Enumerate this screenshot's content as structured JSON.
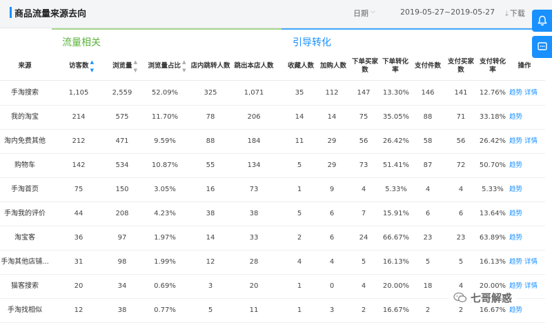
{
  "header": {
    "title": "商品流量来源去向",
    "date_label": "日期",
    "date_range": "2019-05-27~2019-05-27",
    "download_label": "下载"
  },
  "sections": {
    "traffic": "流量相关",
    "conversion": "引导转化"
  },
  "columns": {
    "source": "来源",
    "visitors": "访客数",
    "pageviews": "浏览量",
    "pv_share": "浏览量占比",
    "jump_in": "店内跳转人数",
    "jump_out": "跳出本店人数",
    "favorites": "收藏人数",
    "cart_adds": "加购人数",
    "order_buyers": "下单买家数",
    "order_rate": "下单转化率",
    "paid_items": "支付件数",
    "paid_buyers": "支付买家数",
    "pay_rate": "支付转化率",
    "actions": "操作"
  },
  "rows": [
    {
      "source": "手淘搜索",
      "visitors": "1,105",
      "pageviews": "2,559",
      "pv_share": "52.09%",
      "jump_in": "325",
      "jump_out": "1,071",
      "favorites": "35",
      "cart_adds": "112",
      "order_buyers": "147",
      "order_rate": "13.30%",
      "paid_items": "146",
      "paid_buyers": "141",
      "pay_rate": "12.76%",
      "trend": "趋势",
      "detail": "详情"
    },
    {
      "source": "我的淘宝",
      "visitors": "214",
      "pageviews": "575",
      "pv_share": "11.70%",
      "jump_in": "78",
      "jump_out": "206",
      "favorites": "14",
      "cart_adds": "14",
      "order_buyers": "75",
      "order_rate": "35.05%",
      "paid_items": "88",
      "paid_buyers": "71",
      "pay_rate": "33.18%",
      "trend": "趋势",
      "detail": ""
    },
    {
      "source": "淘内免费其他",
      "visitors": "212",
      "pageviews": "471",
      "pv_share": "9.59%",
      "jump_in": "88",
      "jump_out": "184",
      "favorites": "11",
      "cart_adds": "29",
      "order_buyers": "56",
      "order_rate": "26.42%",
      "paid_items": "58",
      "paid_buyers": "56",
      "pay_rate": "26.42%",
      "trend": "趋势",
      "detail": "详情"
    },
    {
      "source": "购物车",
      "visitors": "142",
      "pageviews": "534",
      "pv_share": "10.87%",
      "jump_in": "55",
      "jump_out": "134",
      "favorites": "5",
      "cart_adds": "29",
      "order_buyers": "73",
      "order_rate": "51.41%",
      "paid_items": "87",
      "paid_buyers": "72",
      "pay_rate": "50.70%",
      "trend": "趋势",
      "detail": ""
    },
    {
      "source": "手淘首页",
      "visitors": "75",
      "pageviews": "150",
      "pv_share": "3.05%",
      "jump_in": "16",
      "jump_out": "73",
      "favorites": "1",
      "cart_adds": "9",
      "order_buyers": "4",
      "order_rate": "5.33%",
      "paid_items": "4",
      "paid_buyers": "4",
      "pay_rate": "5.33%",
      "trend": "趋势",
      "detail": ""
    },
    {
      "source": "手淘我的评价",
      "visitors": "44",
      "pageviews": "208",
      "pv_share": "4.23%",
      "jump_in": "38",
      "jump_out": "38",
      "favorites": "5",
      "cart_adds": "6",
      "order_buyers": "7",
      "order_rate": "15.91%",
      "paid_items": "6",
      "paid_buyers": "6",
      "pay_rate": "13.64%",
      "trend": "趋势",
      "detail": ""
    },
    {
      "source": "淘宝客",
      "visitors": "36",
      "pageviews": "97",
      "pv_share": "1.97%",
      "jump_in": "14",
      "jump_out": "33",
      "favorites": "2",
      "cart_adds": "6",
      "order_buyers": "24",
      "order_rate": "66.67%",
      "paid_items": "23",
      "paid_buyers": "23",
      "pay_rate": "63.89%",
      "trend": "趋势",
      "detail": ""
    },
    {
      "source": "手淘其他店铺...",
      "visitors": "31",
      "pageviews": "98",
      "pv_share": "1.99%",
      "jump_in": "12",
      "jump_out": "28",
      "favorites": "4",
      "cart_adds": "4",
      "order_buyers": "5",
      "order_rate": "16.13%",
      "paid_items": "5",
      "paid_buyers": "5",
      "pay_rate": "16.13%",
      "trend": "趋势",
      "detail": "详情"
    },
    {
      "source": "猫客搜索",
      "visitors": "20",
      "pageviews": "34",
      "pv_share": "0.69%",
      "jump_in": "3",
      "jump_out": "20",
      "favorites": "1",
      "cart_adds": "0",
      "order_buyers": "4",
      "order_rate": "20.00%",
      "paid_items": "18",
      "paid_buyers": "4",
      "pay_rate": "20.00%",
      "trend": "趋势",
      "detail": "详情"
    },
    {
      "source": "手淘找相似",
      "visitors": "12",
      "pageviews": "38",
      "pv_share": "0.77%",
      "jump_in": "5",
      "jump_out": "11",
      "favorites": "1",
      "cart_adds": "3",
      "order_buyers": "2",
      "order_rate": "16.67%",
      "paid_items": "2",
      "paid_buyers": "2",
      "pay_rate": "16.67%",
      "trend": "趋势",
      "detail": ""
    }
  ],
  "watermark": {
    "text": "七哥解惑"
  },
  "colors": {
    "accent": "#1890ff",
    "traffic_green": "#59b33a",
    "traffic_bar": "#a7d58b"
  }
}
